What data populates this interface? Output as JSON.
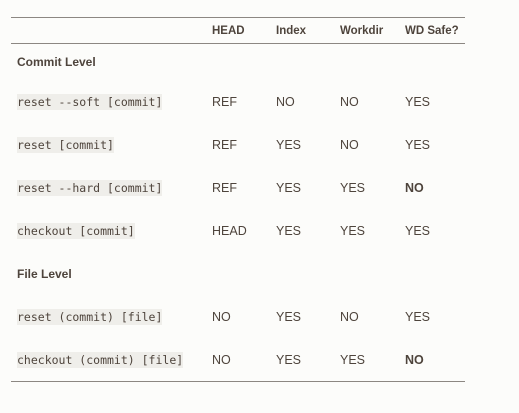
{
  "headers": [
    "",
    "HEAD",
    "Index",
    "Workdir",
    "WD Safe?"
  ],
  "sections": [
    {
      "title": "Commit Level",
      "rows": [
        {
          "command": "reset --soft [commit]",
          "head": "REF",
          "index": "NO",
          "workdir": "NO",
          "wd_safe": "YES",
          "wd_safe_bold": false
        },
        {
          "command": "reset [commit]",
          "head": "REF",
          "index": "YES",
          "workdir": "NO",
          "wd_safe": "YES",
          "wd_safe_bold": false
        },
        {
          "command": "reset --hard [commit]",
          "head": "REF",
          "index": "YES",
          "workdir": "YES",
          "wd_safe": "NO",
          "wd_safe_bold": true
        },
        {
          "command": "checkout [commit]",
          "head": "HEAD",
          "index": "YES",
          "workdir": "YES",
          "wd_safe": "YES",
          "wd_safe_bold": false
        }
      ]
    },
    {
      "title": "File Level",
      "rows": [
        {
          "command": "reset (commit) [file]",
          "head": "NO",
          "index": "YES",
          "workdir": "NO",
          "wd_safe": "YES",
          "wd_safe_bold": false
        },
        {
          "command": "checkout (commit) [file]",
          "head": "NO",
          "index": "YES",
          "workdir": "YES",
          "wd_safe": "NO",
          "wd_safe_bold": true
        }
      ]
    }
  ]
}
